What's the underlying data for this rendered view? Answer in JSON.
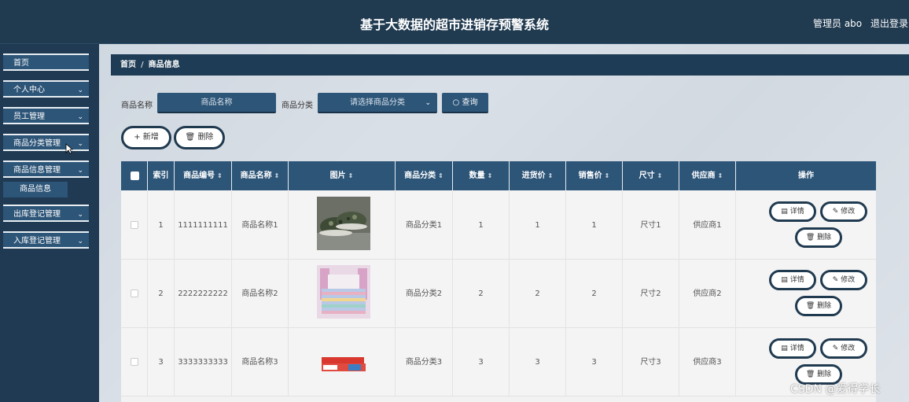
{
  "header": {
    "title": "基于大数据的超市进销存预警系统",
    "admin": "管理员 abo",
    "logout": "退出登录"
  },
  "sidebar": {
    "items": [
      {
        "label": "首页"
      },
      {
        "label": "个人中心"
      },
      {
        "label": "员工管理"
      },
      {
        "label": "商品分类管理"
      },
      {
        "label": "商品信息管理"
      },
      {
        "label": "商品信息"
      },
      {
        "label": "出库登记管理"
      },
      {
        "label": "入库登记管理"
      }
    ]
  },
  "breadcrumb": {
    "home": "首页",
    "separator": "/",
    "current": "商品信息"
  },
  "search": {
    "name_label": "商品名称",
    "name_placeholder": "商品名称",
    "category_label": "商品分类",
    "category_placeholder": "请选择商品分类",
    "search_button": "查询"
  },
  "actions": {
    "add": "新增",
    "delete": "删除"
  },
  "table": {
    "headers": [
      "索引",
      "商品编号",
      "商品名称",
      "图片",
      "商品分类",
      "数量",
      "进货价",
      "销售价",
      "尺寸",
      "供应商",
      "操作"
    ],
    "rows": [
      {
        "index": "1",
        "code": "1111111111",
        "name": "商品名称1",
        "image": "shoes",
        "category": "商品分类1",
        "qty": "1",
        "buy": "1",
        "sell": "1",
        "size": "尺寸1",
        "supplier": "供应商1"
      },
      {
        "index": "2",
        "code": "2222222222",
        "name": "商品名称2",
        "image": "bedding",
        "category": "商品分类2",
        "qty": "2",
        "buy": "2",
        "sell": "2",
        "size": "尺寸2",
        "supplier": "供应商2"
      },
      {
        "index": "3",
        "code": "3333333333",
        "name": "商品名称3",
        "image": "toothpaste",
        "category": "商品分类3",
        "qty": "3",
        "buy": "3",
        "sell": "3",
        "size": "尺寸3",
        "supplier": "供应商3"
      }
    ],
    "row_actions": {
      "detail": "详情",
      "edit": "修改",
      "delete": "删除"
    }
  },
  "watermark": "CSDN @爱得学长",
  "colors": {
    "primary": "#2d5578",
    "dark": "#203a50"
  }
}
